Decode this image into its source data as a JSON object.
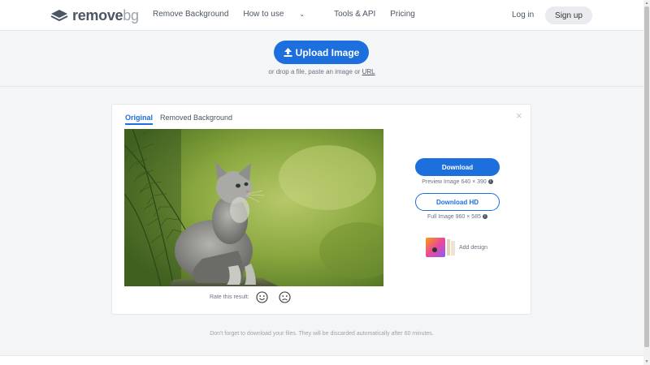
{
  "header": {
    "logo": {
      "word1": "remove",
      "word2": "bg"
    },
    "nav": [
      {
        "label": "Remove Background"
      },
      {
        "label": "How to use"
      },
      {
        "label": "Tools & API"
      },
      {
        "label": "Pricing"
      }
    ],
    "login_label": "Log in",
    "signup_label": "Sign up"
  },
  "upload": {
    "button_label": "Upload Image",
    "hint_prefix": "or drop a file, paste an image or",
    "hint_url": "URL"
  },
  "result": {
    "tabs": [
      {
        "label": "Original",
        "active": true
      },
      {
        "label": "Removed Background",
        "active": false
      }
    ],
    "close_symbol": "×",
    "rate_label": "Rate this result:",
    "download_label": "Download",
    "preview_info": "Preview Image 640 × 390",
    "download_hd_label": "Download HD",
    "full_info": "Full Image 960 × 585",
    "add_design_label": "Add design"
  },
  "footer_note": "Don't forget to download your files. They will be discarded automatically after 60 minutes.",
  "colors": {
    "accent": "#1d6fde",
    "text": "#4b5563",
    "muted": "#6b7280",
    "page_bg": "#f4f5f7"
  }
}
